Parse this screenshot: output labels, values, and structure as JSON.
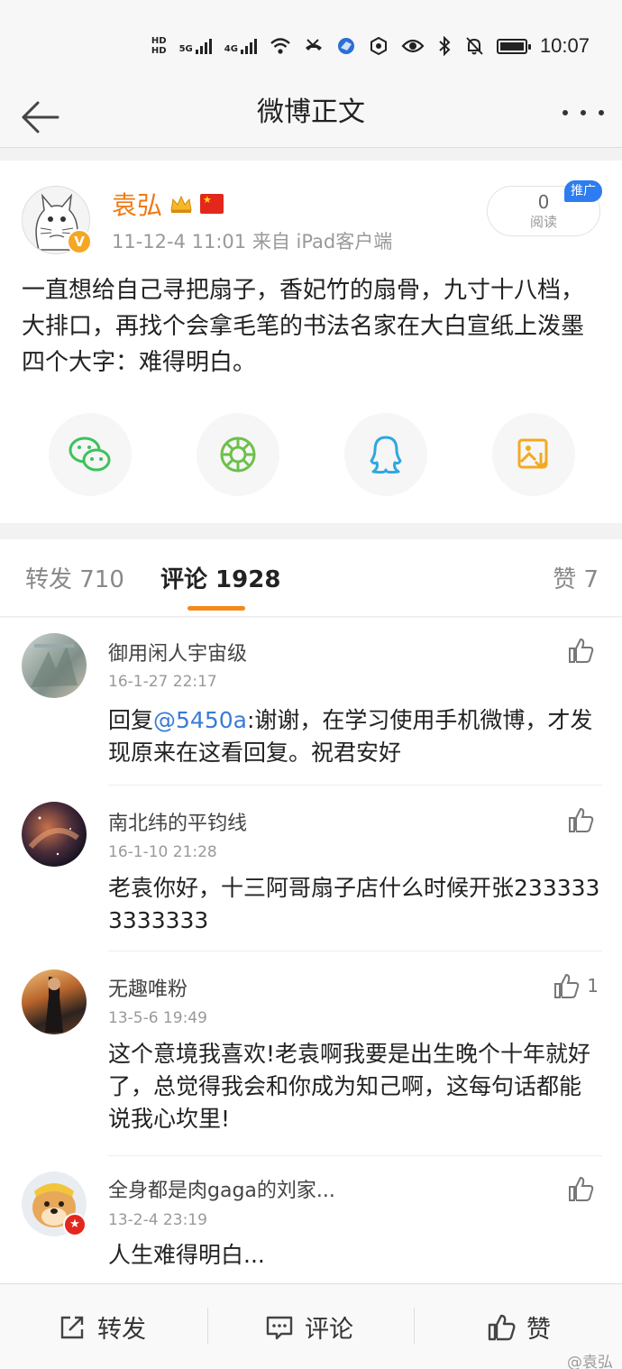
{
  "status_bar": {
    "time": "10:07",
    "hd_top": "HD",
    "hd_bottom": "HD",
    "net1": "5G",
    "net2": "4G"
  },
  "header": {
    "title": "微博正文"
  },
  "post": {
    "author": "袁弘",
    "meta": "11-12-4 11:01  来自 iPad客户端",
    "read_count": "0",
    "read_label": "阅读",
    "promo_badge": "推广",
    "verified_badge": "V",
    "content": "一直想给自己寻把扇子，香妃竹的扇骨，九寸十八档，大排口，再找个会拿毛笔的书法名家在大白宣纸上泼墨四个大字：难得明白。",
    "share_icons": [
      "wechat-icon",
      "moments-icon",
      "qq-icon",
      "save-image-icon"
    ]
  },
  "tabs": {
    "repost": "转发 710",
    "comment": "评论 1928",
    "like": "赞 7",
    "accent_color": "#f28a1c"
  },
  "comments": [
    {
      "name": "御用闲人宇宙级",
      "time": "16-1-27 22:17",
      "text_prefix": "回复",
      "mention": "@5450a",
      "text": ":谢谢，在学习使用手机微博，才发现原来在这看回复。祝君安好",
      "likes": ""
    },
    {
      "name": "南北纬的平钧线",
      "time": "16-1-10 21:28",
      "text_prefix": "",
      "mention": "",
      "text": "老袁你好，十三阿哥扇子店什么时候开张2333333333333",
      "likes": ""
    },
    {
      "name": "无趣唯粉",
      "time": "13-5-6 19:49",
      "text_prefix": "",
      "mention": "",
      "text": "这个意境我喜欢!老袁啊我要是出生晚个十年就好了，总觉得我会和你成为知己啊，这每句话都能说我心坎里!",
      "likes": "1"
    },
    {
      "name": "全身都是肉gaga的刘家...",
      "time": "13-2-4 23:19",
      "text_prefix": "",
      "mention": "",
      "text": "人生难得明白...",
      "likes": ""
    }
  ],
  "toolbar": {
    "repost": "转发",
    "comment": "评论",
    "like": "赞"
  },
  "watermark": "@袁弘"
}
